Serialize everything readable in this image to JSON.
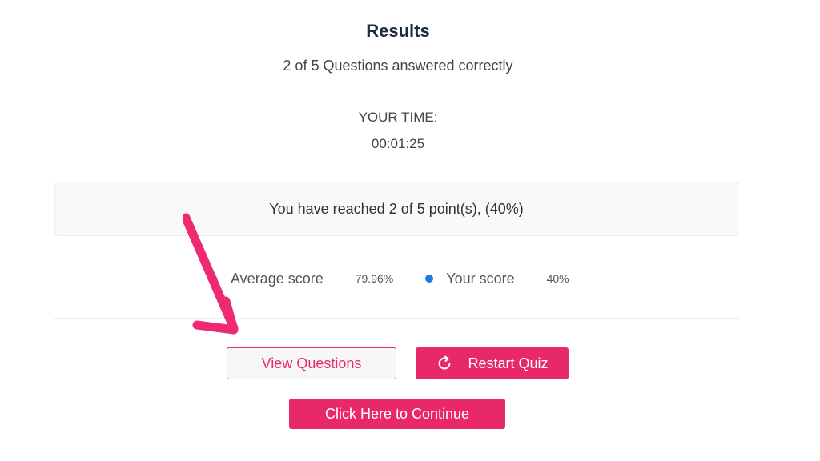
{
  "results": {
    "title": "Results",
    "summary": "2 of 5 Questions answered correctly",
    "time_label": "YOUR TIME:",
    "time_value": "00:01:25",
    "points_message": "You have reached 2 of 5 point(s), (40%)"
  },
  "scores": {
    "average_label": "Average score",
    "average_value": "79.96%",
    "average_color": "#e6c8f0",
    "your_label": "Your score",
    "your_value": "40%",
    "your_color": "#1a7de6"
  },
  "buttons": {
    "view_questions": "View Questions",
    "restart_quiz": "Restart Quiz",
    "restart_icon": "restart-icon",
    "continue": "Click Here to Continue"
  },
  "colors": {
    "accent": "#e9286a",
    "title": "#1e2b3c",
    "annotation_arrow": "#ee2b72"
  }
}
